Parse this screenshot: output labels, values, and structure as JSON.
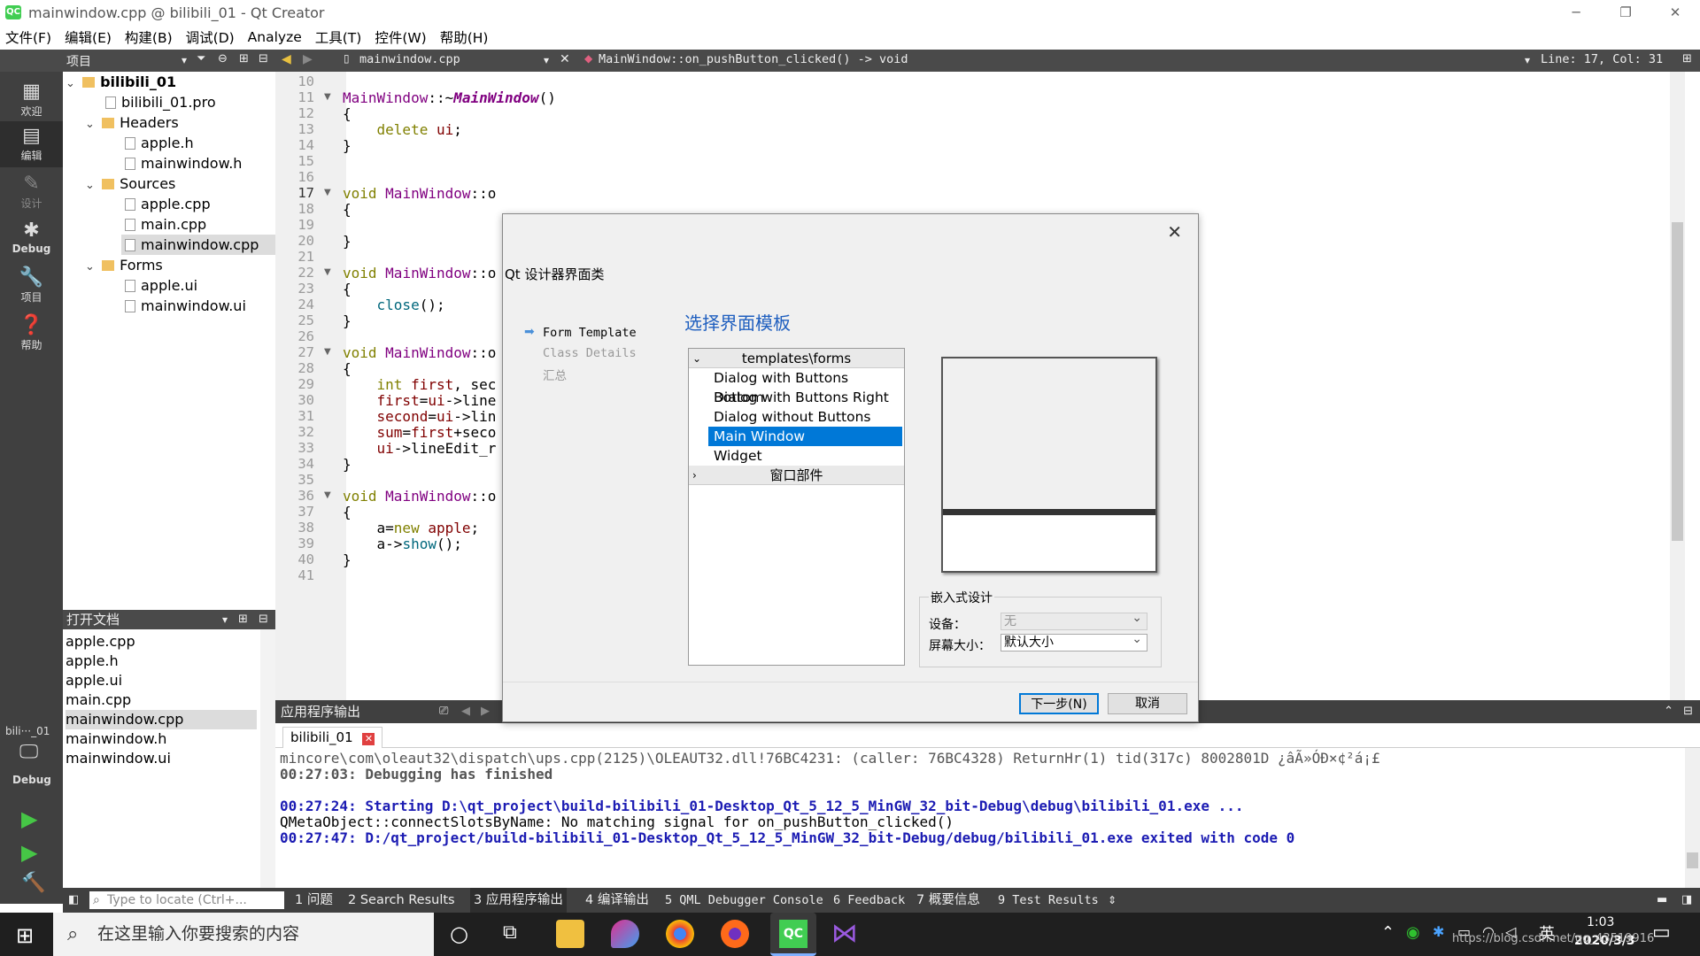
{
  "window": {
    "title": "mainwindow.cpp @ bilibili_01 - Qt Creator",
    "logo": "QC"
  },
  "menu": [
    "文件(F)",
    "编辑(E)",
    "构建(B)",
    "调试(D)",
    "Analyze",
    "工具(T)",
    "控件(W)",
    "帮助(H)"
  ],
  "toolrow": {
    "panel_label": "项目",
    "file": "mainwindow.cpp",
    "function": "MainWindow::on_pushButton_clicked() -> void",
    "cursor": "Line: 17, Col: 31"
  },
  "modes": [
    {
      "label": "欢迎",
      "icon": "grid-icon"
    },
    {
      "label": "编辑",
      "icon": "edit-icon"
    },
    {
      "label": "设计",
      "icon": "pencil-icon"
    },
    {
      "label": "Debug",
      "icon": "bug-icon"
    },
    {
      "label": "项目",
      "icon": "wrench-icon"
    },
    {
      "label": "帮助",
      "icon": "help-icon"
    }
  ],
  "kit": {
    "label": "bili···_01",
    "mode": "Debug"
  },
  "tree": {
    "project": "bilibili_01",
    "pro": "bilibili_01.pro",
    "headers": "Headers",
    "headers_items": [
      "apple.h",
      "mainwindow.h"
    ],
    "sources": "Sources",
    "sources_items": [
      "apple.cpp",
      "main.cpp",
      "mainwindow.cpp"
    ],
    "forms": "Forms",
    "forms_items": [
      "apple.ui",
      "mainwindow.ui"
    ]
  },
  "open_docs": {
    "title": "打开文档",
    "items": [
      "apple.cpp",
      "apple.h",
      "apple.ui",
      "main.cpp",
      "mainwindow.cpp",
      "mainwindow.h",
      "mainwindow.ui"
    ]
  },
  "editor": {
    "line_numbers": [
      "10",
      "11",
      "12",
      "13",
      "14",
      "15",
      "16",
      "17",
      "18",
      "19",
      "20",
      "21",
      "22",
      "23",
      "24",
      "25",
      "26",
      "27",
      "28",
      "29",
      "30",
      "31",
      "32",
      "33",
      "34",
      "35",
      "36",
      "37",
      "38",
      "39",
      "40",
      "41"
    ],
    "lines": [
      "",
      "MainWindow::~MainWindow()",
      "{",
      "    delete ui;",
      "}",
      "",
      "",
      "void MainWindow::o",
      "{",
      "",
      "}",
      "",
      "void MainWindow::o",
      "{",
      "    close();",
      "}",
      "",
      "void MainWindow::o",
      "{",
      "    int first, sec",
      "    first=ui->line",
      "    second=ui->lin",
      "    sum=first+seco",
      "    ui->lineEdit_r",
      "}",
      "",
      "void MainWindow::o",
      "{",
      "    a=new apple;",
      "    a->show();",
      "}",
      ""
    ]
  },
  "output": {
    "header": "应用程序输出",
    "tab": "bilibili_01",
    "lines": [
      "mincore\\com\\oleaut32\\dispatch\\ups.cpp(2125)\\OLEAUT32.dll!76BC4231: (caller: 76BC4328) ReturnHr(1) tid(317c) 8002801D ¿âÃ»ÓÐ×¢²á¡£",
      "00:27:03: Debugging has finished",
      "",
      "00:27:24: Starting D:\\qt_project\\build-bilibili_01-Desktop_Qt_5_12_5_MinGW_32_bit-Debug\\debug\\bilibili_01.exe ...",
      "QMetaObject::connectSlotsByName: No matching signal for on_pushButton_clicked()",
      "00:27:47: D:/qt_project/build-bilibili_01-Desktop_Qt_5_12_5_MinGW_32_bit-Debug/debug/bilibili_01.exe exited with code 0"
    ]
  },
  "statusbar": {
    "locator_placeholder": "Type to locate (Ctrl+...",
    "tabs": [
      "1 问题",
      "2 Search Results",
      "3 应用程序输出",
      "4 编译输出",
      "5 QML Debugger Console",
      "6 Feedback",
      "7 概要信息",
      "9 Test Results"
    ]
  },
  "dialog": {
    "title": "Qt 设计器界面类",
    "steps": [
      "Form Template",
      "Class Details",
      "汇总"
    ],
    "heading": "选择界面模板",
    "group1": "templates\\forms",
    "templates": [
      "Dialog with Buttons Bottom",
      "Dialog with Buttons Right",
      "Dialog without Buttons",
      "Main Window",
      "Widget"
    ],
    "group2": "窗口部件",
    "embedded": {
      "title": "嵌入式设计",
      "device_label": "设备：",
      "device_value": "无",
      "screen_label": "屏幕大小：",
      "screen_value": "默认大小"
    },
    "next": "下一步(N)",
    "cancel": "取消"
  },
  "taskbar": {
    "search": "在这里输入你要搜索的内容",
    "ime": "英",
    "time": "1:03",
    "date": "2020/3/3",
    "watermark": "https://blog.csdn.net/qq_43519916"
  }
}
